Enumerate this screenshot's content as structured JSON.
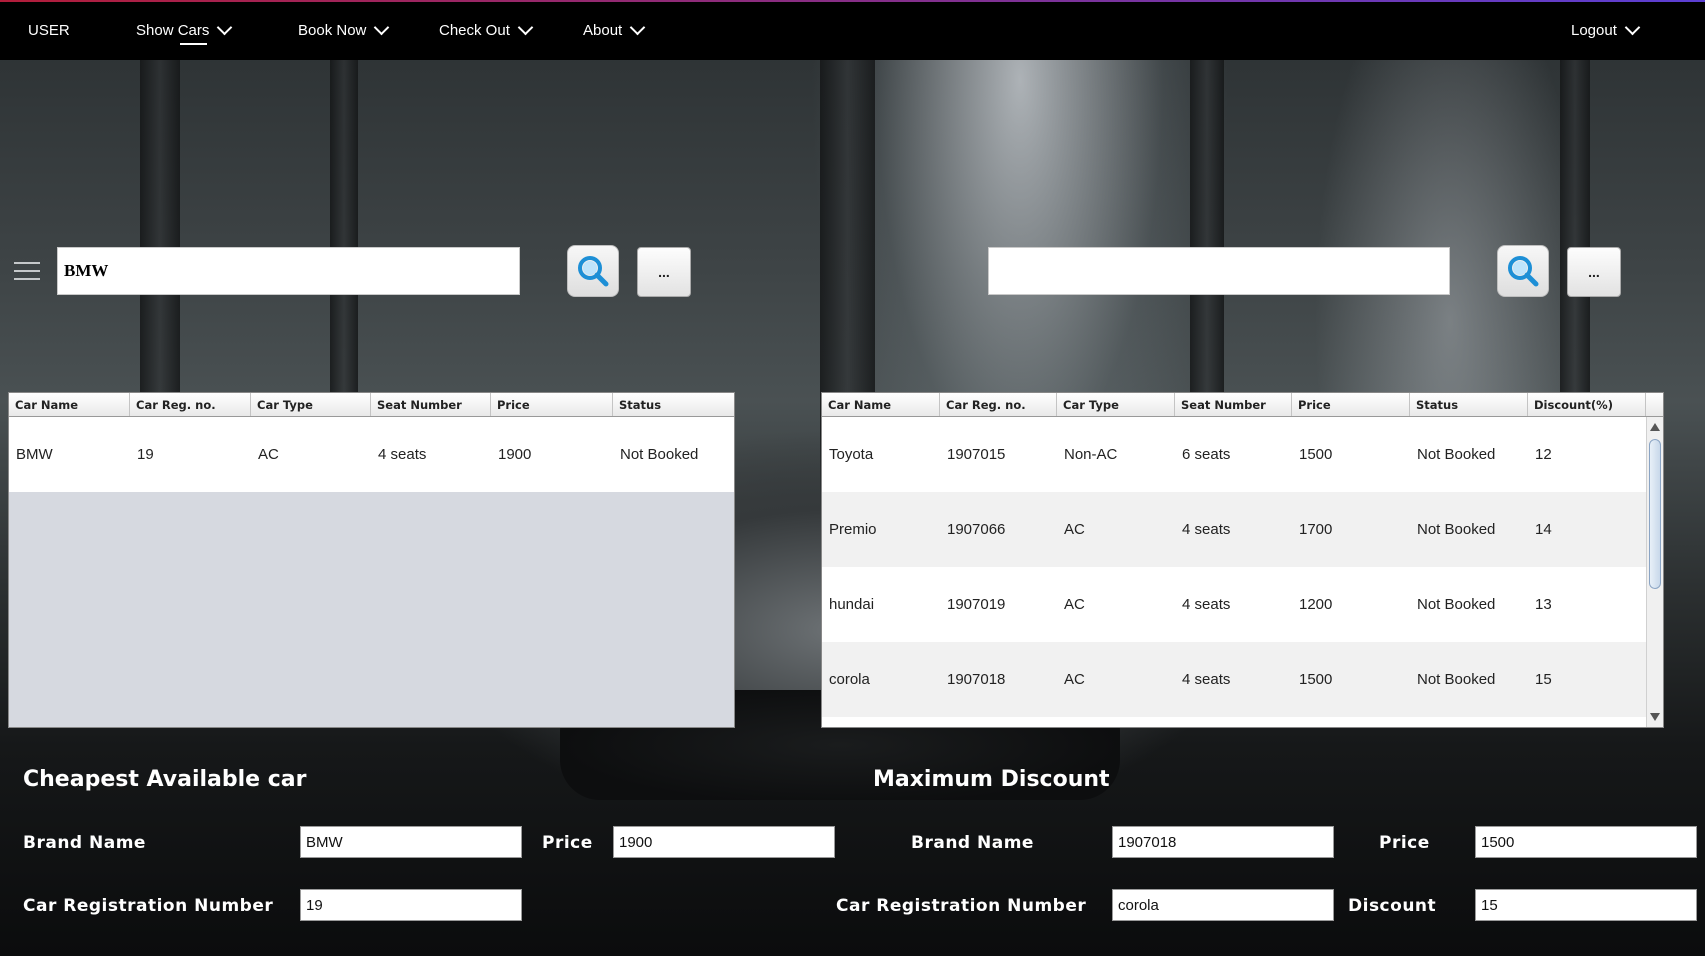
{
  "nav": {
    "user": "USER",
    "show_cars": "Show Cars",
    "book_now": "Book Now",
    "check_out": "Check Out",
    "about": "About",
    "logout": "Logout"
  },
  "search_left": {
    "value": "BMW",
    "more_label": "..."
  },
  "search_right": {
    "value": "",
    "more_label": "..."
  },
  "table_left": {
    "headers": [
      "Car Name",
      "Car Reg. no.",
      "Car Type",
      "Seat Number",
      "Price",
      "Status"
    ],
    "rows": [
      [
        "BMW",
        "19",
        "AC",
        "4 seats",
        "1900",
        "Not Booked"
      ]
    ]
  },
  "table_right": {
    "headers": [
      "Car Name",
      "Car Reg. no.",
      "Car Type",
      "Seat Number",
      "Price",
      "Status",
      "Discount(%)"
    ],
    "rows": [
      [
        "Toyota",
        "1907015",
        "Non-AC",
        "6 seats",
        "1500",
        "Not Booked",
        "12"
      ],
      [
        "Premio",
        "1907066",
        "AC",
        "4 seats",
        "1700",
        "Not Booked",
        "14"
      ],
      [
        "hundai",
        "1907019",
        "AC",
        "4 seats",
        "1200",
        "Not Booked",
        "13"
      ],
      [
        "corola",
        "1907018",
        "AC",
        "4 seats",
        "1500",
        "Not Booked",
        "15"
      ]
    ]
  },
  "cheapest": {
    "title": "Cheapest Available car",
    "brand_label": "Brand Name",
    "brand_value": "BMW",
    "price_label": "Price",
    "price_value": "1900",
    "reg_label": "Car Registration Number",
    "reg_value": "19"
  },
  "max_discount": {
    "title": "Maximum Discount",
    "brand_label": "Brand Name",
    "brand_value": "1907018",
    "price_label": "Price",
    "price_value": "1500",
    "reg_label": "Car Registration Number",
    "reg_value": "corola",
    "discount_label": "Discount",
    "discount_value": "15"
  },
  "colors": {
    "topbar": "#000000",
    "accent_gradient_start": "#b21d3a",
    "accent_gradient_end": "#5b3fd4",
    "table_empty_bg": "#d6d9e0"
  }
}
